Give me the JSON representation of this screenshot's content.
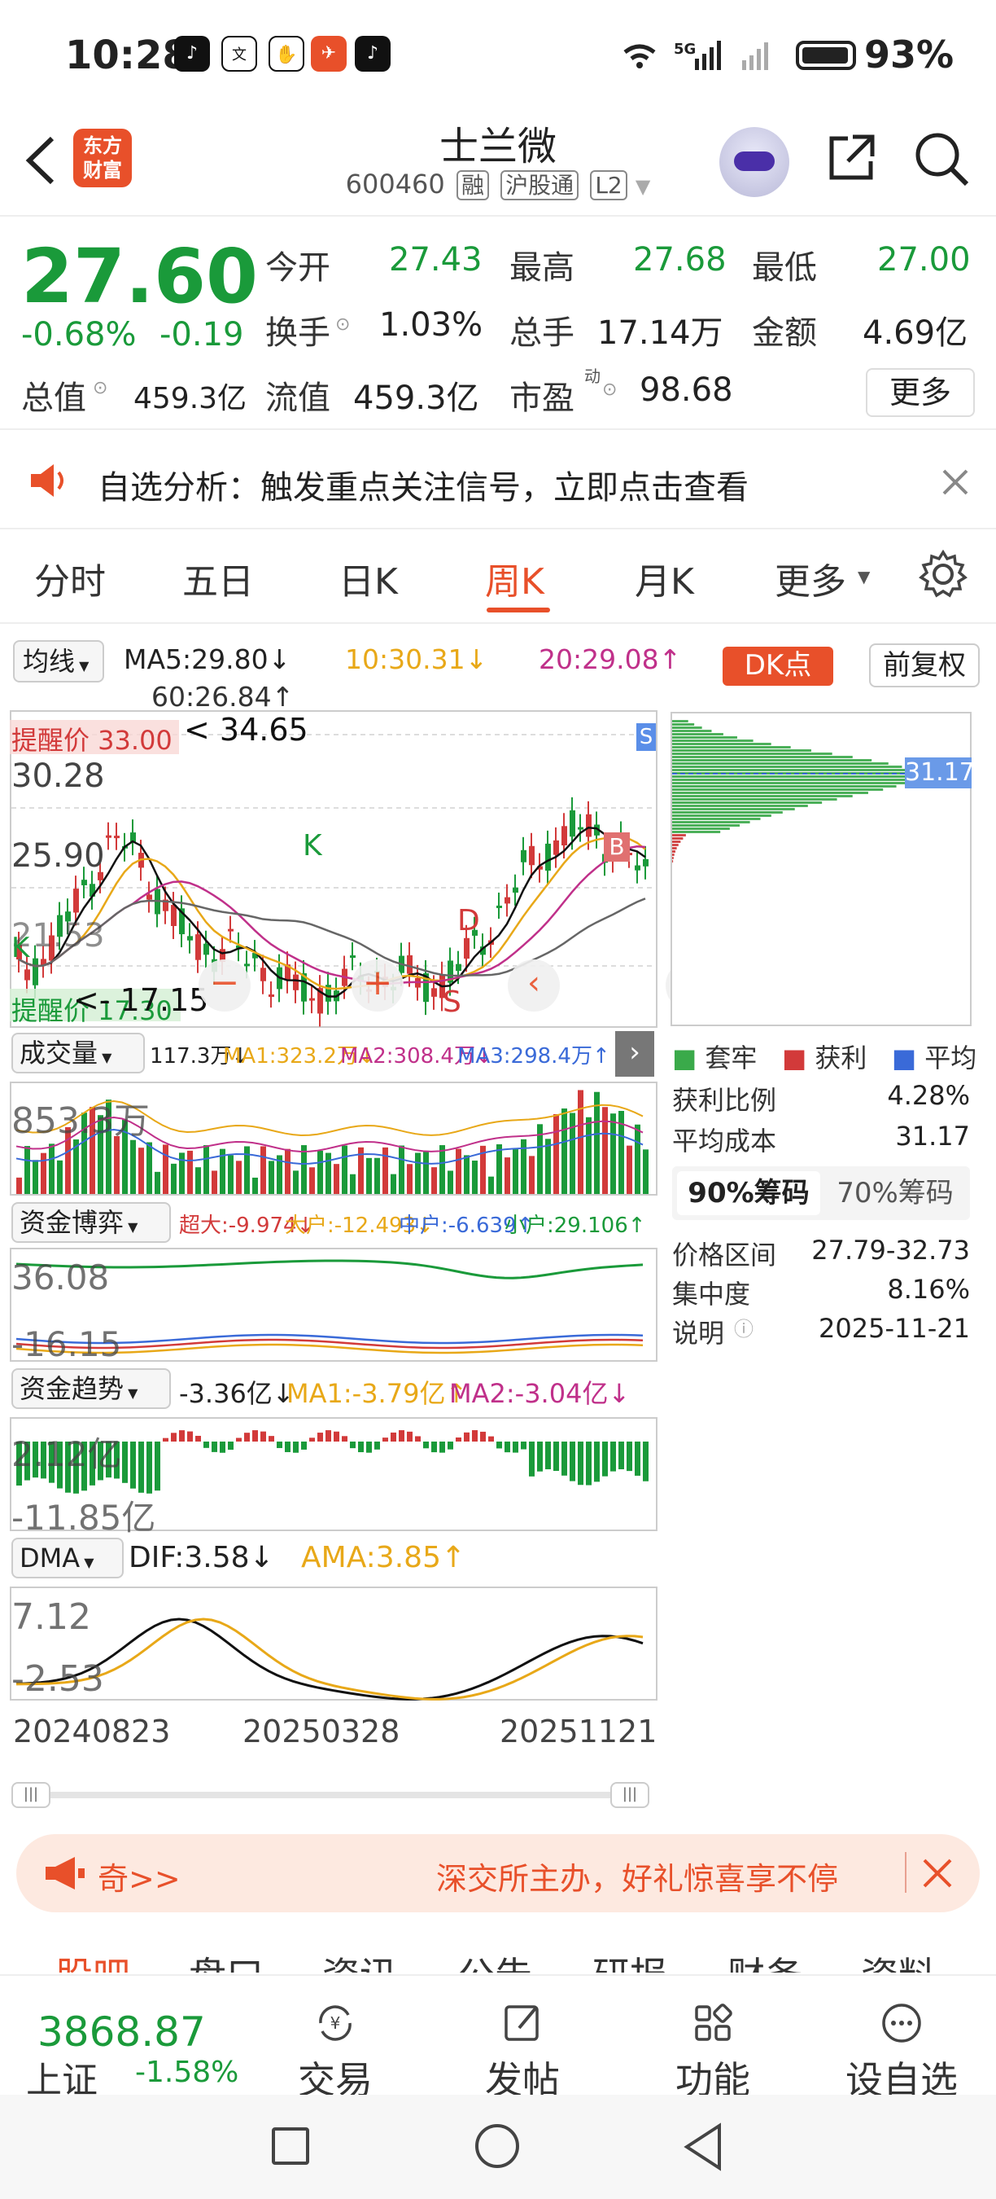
{
  "status_bar": {
    "time": "10:28",
    "battery": "93%",
    "network": "5G"
  },
  "header": {
    "back_icon": "back-arrow-icon",
    "logo": "东方\n财富",
    "title": "士兰微",
    "code": "600460",
    "tags": [
      "融",
      "沪股通",
      "L2"
    ],
    "share_icon": "share-icon",
    "search_icon": "search-icon"
  },
  "quote": {
    "price": "27.60",
    "change_pct": "-0.68%",
    "change": "-0.19",
    "open_label": "今开",
    "open": "27.43",
    "high_label": "最高",
    "high": "27.68",
    "low_label": "最低",
    "low": "27.00",
    "turnover_label": "换手",
    "turnover": "1.03%",
    "volume_label": "总手",
    "volume": "17.14万",
    "amount_label": "金额",
    "amount": "4.69亿",
    "mktcap_label": "总值",
    "mktcap": "459.3亿",
    "float_label": "流值",
    "float": "459.3亿",
    "pe_label": "市盈",
    "pe_sup": "动",
    "pe": "98.68",
    "more": "更多"
  },
  "notice": {
    "text": "自选分析：触发重点关注信号，立即点击查看"
  },
  "tabs": [
    "分时",
    "五日",
    "日K",
    "周K",
    "月K",
    "更多"
  ],
  "active_tab": "周K",
  "indicators": {
    "ma_select": "均线",
    "ma5": "MA5:29.80↓",
    "ma10": "10:30.31↓",
    "ma20": "20:29.08↑",
    "ma60": "60:26.84↑",
    "dk": "DK点",
    "fq": "前复权"
  },
  "kline": {
    "price_labels": [
      "34.65",
      "30.28",
      "25.90",
      "21.53"
    ],
    "high_label": "34.65",
    "remind": "提醒价 33.00",
    "remind_low": "提醒价 17.30",
    "low_label": "17.15",
    "markers": [
      "S",
      "B",
      "K",
      "D",
      "S",
      "K"
    ]
  },
  "volume_panel": {
    "select": "成交量",
    "val": "117.3万↓",
    "ma1": "MA1:323.2万↓",
    "ma2": "MA2:308.4万↓",
    "ma3": "MA3:298.4万↑",
    "axis": "853.3万"
  },
  "fund_game": {
    "select": "资金博弈",
    "super": "超大:-9.974↓",
    "big": "大户:-12.493↓",
    "mid": "中户:-6.639↑",
    "small": "小户:29.106↑",
    "axis_top": "36.08",
    "axis_bottom": "-16.15"
  },
  "fund_trend": {
    "select": "资金趋势",
    "val": "-3.36亿↓",
    "ma1": "MA1:-3.79亿↑",
    "ma2": "MA2:-3.04亿↓",
    "axis_top": "2.12亿",
    "axis_bottom": "-11.85亿"
  },
  "dma": {
    "select": "DMA",
    "dif": "DIF:3.58↓",
    "ama": "AMA:3.85↑",
    "axis_top": "7.12",
    "axis_bottom": "-2.53"
  },
  "dates": [
    "20240823",
    "20250328",
    "20251121"
  ],
  "chips": {
    "current": "31.17",
    "legend": [
      "套牢",
      "获利",
      "平均"
    ],
    "profit_ratio_label": "获利比例",
    "profit_ratio": "4.28%",
    "avg_cost_label": "平均成本",
    "avg_cost": "31.17",
    "tab90": "90%筹码",
    "tab70": "70%筹码",
    "range_label": "价格区间",
    "range": "27.79-32.73",
    "concentration_label": "集中度",
    "concentration": "8.16%",
    "note_label": "说明",
    "note_date": "2025-11-21"
  },
  "banner": {
    "left": "奇>>",
    "right": "深交所主办，好礼惊喜享不停"
  },
  "nav_tabs": [
    "股吧",
    "盘口",
    "资讯",
    "公告",
    "研报",
    "财务",
    "资料"
  ],
  "bottom_bar": {
    "index_value": "3868.87",
    "index_name": "上证",
    "index_change": "-1.58%",
    "items": [
      "交易",
      "发帖",
      "功能",
      "设自选"
    ]
  },
  "colors": {
    "up": "#d23a3a",
    "down": "#1a9a3a",
    "accent": "#e8502a"
  }
}
